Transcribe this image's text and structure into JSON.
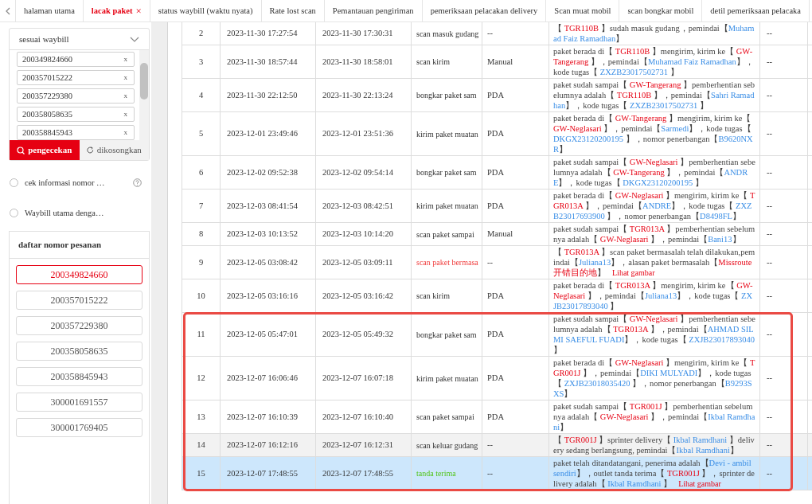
{
  "tabs": [
    {
      "label": "halaman utama",
      "selected": false,
      "closable": false
    },
    {
      "label": "lacak paket",
      "selected": true,
      "closable": true
    },
    {
      "label": "status waybill (waktu nyata)",
      "selected": false,
      "closable": false
    },
    {
      "label": "Rate lost scan",
      "selected": false,
      "closable": false
    },
    {
      "label": "Pemantauan pengiriman",
      "selected": false,
      "closable": false
    },
    {
      "label": "pemeriksaan pelacakan delivery",
      "selected": false,
      "closable": false
    },
    {
      "label": "Scan muat mobil",
      "selected": false,
      "closable": false
    },
    {
      "label": "scan bongkar mobil",
      "selected": false,
      "closable": false
    },
    {
      "label": "detil pemeriksaan pelacaka",
      "selected": false,
      "closable": false
    }
  ],
  "tab_close_mark": "×",
  "search": {
    "mode": "sesuai waybill",
    "waybills": [
      {
        "number": "200349824660",
        "remove": "x"
      },
      {
        "number": "200357015222",
        "remove": "x"
      },
      {
        "number": "200357229380",
        "remove": "x"
      },
      {
        "number": "200358058635",
        "remove": "x"
      },
      {
        "number": "200358845943",
        "remove": "x"
      }
    ],
    "buttons": [
      {
        "label": "pengecekan",
        "kind": "primary"
      },
      {
        "label": "dikosongkan",
        "kind": "reset"
      }
    ]
  },
  "options": [
    {
      "label": "cek informasi nomor …",
      "selected": false,
      "help": true
    },
    {
      "label": "Waybill utama denga…",
      "selected": false,
      "help": false
    }
  ],
  "order_list": {
    "title": "daftar nomor pesanan",
    "items": [
      {
        "number": "200349824660",
        "selected": true
      },
      {
        "number": "200357015222",
        "selected": false
      },
      {
        "number": "200357229380",
        "selected": false
      },
      {
        "number": "200358058635",
        "selected": false
      },
      {
        "number": "200358845943",
        "selected": false
      },
      {
        "number": "300001691557",
        "selected": false
      },
      {
        "number": "300001769405",
        "selected": false
      }
    ]
  },
  "table": {
    "rows": [
      {
        "no": "2",
        "time_1": "2023-11-30 17:27:54",
        "time_2": "2023-11-30 17:30:31",
        "type": {
          "text": "scan masuk gudang",
          "kind": "normal"
        },
        "source": "--",
        "column_7": "--",
        "hovered": false,
        "selected": false,
        "boxed": false,
        "detail": [
          {
            "text": "【 ",
            "kind": "text"
          },
          {
            "text": "TGR110B",
            "kind": "place"
          },
          {
            "text": " 】sudah masuk gudang，pemindai【",
            "kind": "text"
          },
          {
            "text": "Muhamad Faiz Ramadhan",
            "kind": "ref"
          },
          {
            "text": "】",
            "kind": "text"
          }
        ]
      },
      {
        "no": "3",
        "time_1": "2023-11-30 18:57:44",
        "time_2": "2023-11-30 18:58:01",
        "type": {
          "text": "scan kirim",
          "kind": "normal"
        },
        "source": "Manual",
        "column_7": "--",
        "hovered": false,
        "selected": false,
        "boxed": false,
        "detail": [
          {
            "text": "paket berada di【 ",
            "kind": "text"
          },
          {
            "text": "TGR110B",
            "kind": "place"
          },
          {
            "text": " 】mengirim, kirim ke【 ",
            "kind": "text"
          },
          {
            "text": "GW-Tangerang",
            "kind": "place"
          },
          {
            "text": " 】，pemindai【",
            "kind": "text"
          },
          {
            "text": "Muhamad Faiz Ramadhan",
            "kind": "ref"
          },
          {
            "text": "】，kode tugas【 ",
            "kind": "text"
          },
          {
            "text": "ZXZB23017502731",
            "kind": "ref"
          },
          {
            "text": " 】",
            "kind": "text"
          }
        ]
      },
      {
        "no": "4",
        "time_1": "2023-11-30 22:12:50",
        "time_2": "2023-11-30 22:13:24",
        "type": {
          "text": "bongkar paket sam",
          "kind": "normal"
        },
        "source": "PDA",
        "column_7": "--",
        "hovered": false,
        "selected": false,
        "boxed": false,
        "detail": [
          {
            "text": "paket sudah sampai【 ",
            "kind": "text"
          },
          {
            "text": "GW-Tangerang",
            "kind": "place"
          },
          {
            "text": " 】pemberhentian sebelumnya adalah【 ",
            "kind": "text"
          },
          {
            "text": "TGR110B",
            "kind": "place"
          },
          {
            "text": " 】，pemindai【",
            "kind": "text"
          },
          {
            "text": "Sahri Ramadhan",
            "kind": "ref"
          },
          {
            "text": "】，kode tugas【 ",
            "kind": "text"
          },
          {
            "text": "ZXZB23017502731",
            "kind": "ref"
          },
          {
            "text": " 】",
            "kind": "text"
          }
        ]
      },
      {
        "no": "5",
        "time_1": "2023-12-01 23:49:46",
        "time_2": "2023-12-01 23:51:36",
        "type": {
          "text": "kirim paket muatan",
          "kind": "normal"
        },
        "source": "PDA",
        "column_7": "--",
        "hovered": false,
        "selected": false,
        "boxed": false,
        "detail": [
          {
            "text": "paket berada di【 ",
            "kind": "text"
          },
          {
            "text": "GW-Tangerang",
            "kind": "place"
          },
          {
            "text": " 】mengirim, kirim ke【 ",
            "kind": "text"
          },
          {
            "text": "GW-Neglasari",
            "kind": "place"
          },
          {
            "text": " 】，pemindai【",
            "kind": "text"
          },
          {
            "text": "Sarmedi",
            "kind": "ref"
          },
          {
            "text": "】，kode tugas【 ",
            "kind": "text"
          },
          {
            "text": "DKGX23120200195",
            "kind": "ref"
          },
          {
            "text": " 】，nomor penerbangan【",
            "kind": "text"
          },
          {
            "text": "B9620NXR",
            "kind": "ref"
          },
          {
            "text": "】",
            "kind": "text"
          }
        ]
      },
      {
        "no": "6",
        "time_1": "2023-12-02 09:52:38",
        "time_2": "2023-12-02 09:54:14",
        "type": {
          "text": "bongkar paket sam",
          "kind": "normal"
        },
        "source": "PDA",
        "column_7": "--",
        "hovered": false,
        "selected": false,
        "boxed": false,
        "detail": [
          {
            "text": "paket sudah sampai【 ",
            "kind": "text"
          },
          {
            "text": "GW-Neglasari",
            "kind": "place"
          },
          {
            "text": " 】pemberhentian sebelumnya adalah【 ",
            "kind": "text"
          },
          {
            "text": "GW-Tangerang",
            "kind": "place"
          },
          {
            "text": " 】，pemindai【",
            "kind": "text"
          },
          {
            "text": "ANDRE",
            "kind": "ref"
          },
          {
            "text": "】，kode tugas【 ",
            "kind": "text"
          },
          {
            "text": "DKGX23120200195",
            "kind": "ref"
          },
          {
            "text": " 】",
            "kind": "text"
          }
        ]
      },
      {
        "no": "7",
        "time_1": "2023-12-03 08:41:54",
        "time_2": "2023-12-03 08:42:51",
        "type": {
          "text": "kirim paket muatan",
          "kind": "normal"
        },
        "source": "PDA",
        "column_7": "--",
        "hovered": false,
        "selected": false,
        "boxed": false,
        "detail": [
          {
            "text": "paket berada di【 ",
            "kind": "text"
          },
          {
            "text": "GW-Neglasari",
            "kind": "place"
          },
          {
            "text": " 】mengirim, kirim ke【 ",
            "kind": "text"
          },
          {
            "text": "TGR013A",
            "kind": "place"
          },
          {
            "text": " 】，pemindai【",
            "kind": "text"
          },
          {
            "text": "ANDRE",
            "kind": "ref"
          },
          {
            "text": "】，kode tugas【 ",
            "kind": "text"
          },
          {
            "text": "ZXZB23017693900",
            "kind": "ref"
          },
          {
            "text": " 】，nomor penerbangan【",
            "kind": "text"
          },
          {
            "text": "D8498FL",
            "kind": "ref"
          },
          {
            "text": "】",
            "kind": "text"
          }
        ]
      },
      {
        "no": "8",
        "time_1": "2023-12-03 10:13:52",
        "time_2": "2023-12-03 10:14:20",
        "type": {
          "text": "scan paket sampai",
          "kind": "normal"
        },
        "source": "Manual",
        "column_7": "--",
        "hovered": false,
        "selected": false,
        "boxed": false,
        "detail": [
          {
            "text": "paket sudah sampai【 ",
            "kind": "text"
          },
          {
            "text": "TGR013A",
            "kind": "place"
          },
          {
            "text": " 】pemberhentian sebelumnya adalah【 ",
            "kind": "text"
          },
          {
            "text": "GW-Neglasari",
            "kind": "place"
          },
          {
            "text": " 】，pemindai【",
            "kind": "text"
          },
          {
            "text": "Bani13",
            "kind": "ref"
          },
          {
            "text": "】",
            "kind": "text"
          }
        ]
      },
      {
        "no": "9",
        "time_1": "2023-12-05 03:08:42",
        "time_2": "2023-12-05 03:09:11",
        "type": {
          "text": "scan paket bermasa",
          "kind": "problem"
        },
        "source": "--",
        "column_7": "--",
        "hovered": false,
        "selected": false,
        "boxed": false,
        "detail": [
          {
            "text": "【 ",
            "kind": "text"
          },
          {
            "text": "TGR013A",
            "kind": "place"
          },
          {
            "text": " 】scan paket bermasalah telah dilakukan,pemindai【",
            "kind": "text"
          },
          {
            "text": "Juliana13",
            "kind": "ref"
          },
          {
            "text": "】，alasan paket bermasalah【",
            "kind": "text"
          },
          {
            "text": "Missroute开错目的地",
            "kind": "place"
          },
          {
            "text": "】",
            "kind": "text"
          },
          {
            "text": "Lihat gambar",
            "kind": "link"
          }
        ]
      },
      {
        "no": "10",
        "time_1": "2023-12-05 03:16:16",
        "time_2": "2023-12-05 03:16:42",
        "type": {
          "text": "scan kirim",
          "kind": "normal"
        },
        "source": "PDA",
        "column_7": "--",
        "hovered": false,
        "selected": false,
        "boxed": false,
        "detail": [
          {
            "text": "paket berada di【 ",
            "kind": "text"
          },
          {
            "text": "TGR013A",
            "kind": "place"
          },
          {
            "text": " 】mengirim, kirim ke【 ",
            "kind": "text"
          },
          {
            "text": "GW-Neglasari",
            "kind": "place"
          },
          {
            "text": " 】，pemindai【",
            "kind": "text"
          },
          {
            "text": "Juliana13",
            "kind": "ref"
          },
          {
            "text": "】，kode tugas【 ",
            "kind": "text"
          },
          {
            "text": "ZXJB23017893040",
            "kind": "ref"
          },
          {
            "text": " 】",
            "kind": "text"
          }
        ]
      },
      {
        "no": "11",
        "time_1": "2023-12-05 05:47:01",
        "time_2": "2023-12-05 05:49:32",
        "type": {
          "text": "bongkar paket sam",
          "kind": "normal"
        },
        "source": "PDA",
        "column_7": "--",
        "hovered": false,
        "selected": false,
        "boxed": true,
        "detail": [
          {
            "text": "paket sudah sampai【 ",
            "kind": "text"
          },
          {
            "text": "GW-Neglasari",
            "kind": "place"
          },
          {
            "text": " 】pemberhentian sebelumnya adalah【 ",
            "kind": "text"
          },
          {
            "text": "TGR013A",
            "kind": "place"
          },
          {
            "text": " 】，pemindai【",
            "kind": "text"
          },
          {
            "text": "AHMAD SILMI SAEFUL FUADI",
            "kind": "ref"
          },
          {
            "text": "】，kode tugas【 ",
            "kind": "text"
          },
          {
            "text": "ZXJB23017893040",
            "kind": "ref"
          },
          {
            "text": " 】",
            "kind": "text"
          }
        ]
      },
      {
        "no": "12",
        "time_1": "2023-12-07 16:06:46",
        "time_2": "2023-12-07 16:07:18",
        "type": {
          "text": "kirim paket muatan",
          "kind": "normal"
        },
        "source": "PDA",
        "column_7": "--",
        "hovered": false,
        "selected": false,
        "boxed": true,
        "detail": [
          {
            "text": "paket berada di【 ",
            "kind": "text"
          },
          {
            "text": "GW-Neglasari",
            "kind": "place"
          },
          {
            "text": " 】mengirim, kirim ke【 ",
            "kind": "text"
          },
          {
            "text": "TGR001J",
            "kind": "place"
          },
          {
            "text": " 】，pemindai【",
            "kind": "text"
          },
          {
            "text": "DIKI MULYADI",
            "kind": "ref"
          },
          {
            "text": "】，kode tugas【 ",
            "kind": "text"
          },
          {
            "text": "ZXJB23018035420",
            "kind": "ref"
          },
          {
            "text": " 】，nomor penerbangan【",
            "kind": "text"
          },
          {
            "text": "B9293SXS",
            "kind": "ref"
          },
          {
            "text": "】",
            "kind": "text"
          }
        ]
      },
      {
        "no": "13",
        "time_1": "2023-12-07 16:10:39",
        "time_2": "2023-12-07 16:10:40",
        "type": {
          "text": "scan paket sampai",
          "kind": "normal"
        },
        "source": "PDA",
        "column_7": "--",
        "hovered": false,
        "selected": false,
        "boxed": true,
        "detail": [
          {
            "text": "paket sudah sampai【 ",
            "kind": "text"
          },
          {
            "text": "TGR001J",
            "kind": "place"
          },
          {
            "text": " 】pemberhentian sebelumnya adalah【 ",
            "kind": "text"
          },
          {
            "text": "GW-Neglasari",
            "kind": "place"
          },
          {
            "text": " 】，pemindai【",
            "kind": "text"
          },
          {
            "text": "Ikbal Ramdhani",
            "kind": "ref"
          },
          {
            "text": "】",
            "kind": "text"
          }
        ]
      },
      {
        "no": "14",
        "time_1": "2023-12-07 16:12:16",
        "time_2": "2023-12-07 16:12:31",
        "type": {
          "text": "scan keluar gudang",
          "kind": "normal"
        },
        "source": "--",
        "column_7": "--",
        "hovered": true,
        "selected": false,
        "boxed": true,
        "detail": [
          {
            "text": "【 ",
            "kind": "text"
          },
          {
            "text": "TGR001J",
            "kind": "place"
          },
          {
            "text": " 】sprinter delivery【 ",
            "kind": "text"
          },
          {
            "text": "Ikbal Ramdhani",
            "kind": "ref"
          },
          {
            "text": " 】delivery sedang berlangsung, pemindai【",
            "kind": "text"
          },
          {
            "text": "Ikbal Ramdhani",
            "kind": "ref"
          },
          {
            "text": "】",
            "kind": "text"
          }
        ]
      },
      {
        "no": "15",
        "time_1": "2023-12-07 17:48:55",
        "time_2": "2023-12-07 17:48:55",
        "type": {
          "text": "tanda terima",
          "kind": "signed"
        },
        "source": "--",
        "column_7": "--",
        "hovered": false,
        "selected": true,
        "boxed": true,
        "detail": [
          {
            "text": "paket telah ditandatangani, penerima adalah【",
            "kind": "text"
          },
          {
            "text": "Devi - ambil sendiri",
            "kind": "ref"
          },
          {
            "text": "】，outlet tanda terima【 ",
            "kind": "text"
          },
          {
            "text": "TGR001J",
            "kind": "place"
          },
          {
            "text": " 】，sprinter delivery adalah【 ",
            "kind": "text"
          },
          {
            "text": "Ikbal Ramdhani",
            "kind": "ref"
          },
          {
            "text": " 】",
            "kind": "text"
          },
          {
            "text": "Lihat gambar",
            "kind": "link"
          }
        ]
      }
    ]
  }
}
